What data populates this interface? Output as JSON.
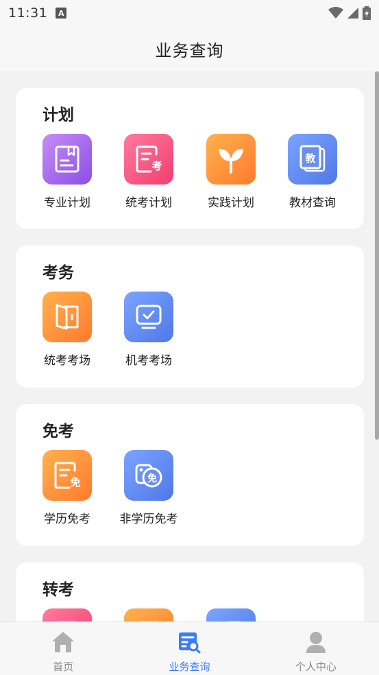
{
  "status_bar": {
    "time": "11:31",
    "notification_badge": "A"
  },
  "header": {
    "title": "业务查询"
  },
  "sections": [
    {
      "title": "计划",
      "items": [
        {
          "label": "专业计划",
          "icon": "book-icon",
          "color": "purple"
        },
        {
          "label": "统考计划",
          "icon": "exam-document-icon",
          "color": "pink"
        },
        {
          "label": "实践计划",
          "icon": "sprout-icon",
          "color": "orange"
        },
        {
          "label": "教材查询",
          "icon": "textbook-icon",
          "color": "blue",
          "glyph": "教"
        }
      ]
    },
    {
      "title": "考务",
      "items": [
        {
          "label": "统考考场",
          "icon": "door-icon",
          "color": "orange"
        },
        {
          "label": "机考考场",
          "icon": "monitor-check-icon",
          "color": "blue"
        }
      ]
    },
    {
      "title": "免考",
      "items": [
        {
          "label": "学历免考",
          "icon": "exemption-document-icon",
          "color": "orange",
          "glyph": "免"
        },
        {
          "label": "非学历免考",
          "icon": "exemption-badge-icon",
          "color": "blue",
          "glyph": "免"
        }
      ]
    },
    {
      "title": "转考",
      "items": [
        {
          "label": "",
          "icon": "transfer-icon-1",
          "color": "pink"
        },
        {
          "label": "",
          "icon": "transfer-icon-2",
          "color": "orange"
        },
        {
          "label": "",
          "icon": "transfer-icon-3",
          "color": "blue"
        }
      ]
    }
  ],
  "bottom_nav": [
    {
      "label": "首页",
      "icon": "home-icon",
      "active": false
    },
    {
      "label": "业务查询",
      "icon": "search-document-icon",
      "active": true
    },
    {
      "label": "个人中心",
      "icon": "user-icon",
      "active": false
    }
  ],
  "colors": {
    "accent": "#3a7cf6",
    "purple": "#9c5ef0",
    "pink": "#f24e7a",
    "orange": "#ff8a35",
    "blue": "#5b82ee"
  }
}
